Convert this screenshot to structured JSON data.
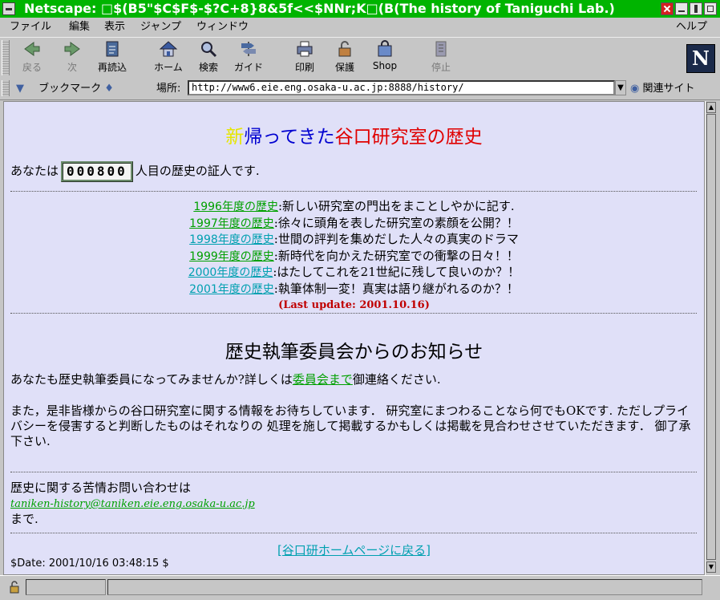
{
  "window": {
    "title": "Netscape: □$(B5\"$C$F$-$?C+8}8&5f<<$NNr;K□(B(The history of Taniguchi Lab.)"
  },
  "menu": {
    "items": [
      "ファイル",
      "編集",
      "表示",
      "ジャンプ",
      "ウィンドウ"
    ],
    "help": "ヘルプ"
  },
  "toolbar": {
    "back": "戻る",
    "forward": "次",
    "reload": "再読込",
    "home": "ホーム",
    "search": "検索",
    "guide": "ガイド",
    "print": "印刷",
    "security": "保護",
    "shop": "Shop",
    "stop": "停止"
  },
  "location": {
    "bookmarks": "ブックマーク",
    "label": "場所:",
    "url": "http://www6.eie.eng.osaka-u.ac.jp:8888/history/",
    "related": "関連サイト"
  },
  "page": {
    "title_part1": "新",
    "title_part2": "帰ってきた",
    "title_part3": "谷口研究室の歴史",
    "counter_prefix": "あなたは",
    "counter_value": "000800",
    "counter_suffix": "人目の歴史の証人です.",
    "history": [
      {
        "link": "1996年度の歴史",
        "desc": ":新しい研究室の門出をまことしやかに記す.",
        "color": "#00a000"
      },
      {
        "link": "1997年度の歴史",
        "desc": ":徐々に頭角を表した研究室の素顔を公開？！",
        "color": "#00a000"
      },
      {
        "link": "1998年度の歴史",
        "desc": ":世間の評判を集めだした人々の真実のドラマ",
        "color": "#00a0b0"
      },
      {
        "link": "1999年度の歴史",
        "desc": ":新時代を向かえた研究室での衝撃の日々！！",
        "color": "#00a000"
      },
      {
        "link": "2000年度の歴史",
        "desc": ":はたしてこれを21世紀に残して良いのか？！",
        "color": "#00a0b0"
      },
      {
        "link": "2001年度の歴史",
        "desc": ":執筆体制一変！真実は語り継がれるのか？！",
        "color": "#00a0b0"
      }
    ],
    "last_update": "(Last update: 2001.10.16)",
    "notice_title": "歴史執筆委員会からのお知らせ",
    "invite_prefix": "あなたも歴史執筆委員になってみませんか?詳しくは",
    "invite_link": "委員会まで",
    "invite_suffix": "御連絡ください.",
    "info_para": "また，是非皆様からの谷口研究室に関する情報をお待ちしています． 研究室にまつわることなら何でもOKです. ただしプライバシーを侵害すると判断したものはそれなりの 処理を施して掲載するかもしくは掲載を見合わせさせていただきます． 御了承下さい.",
    "complaint_text": "歴史に関する苦情お問い合わせは",
    "email": "taniken-history@taniken.eie.eng.osaka-u.ac.jp",
    "made": "まで.",
    "back_link": "[谷口研ホームページに戻る]",
    "date": "$Date: 2001/10/16 03:48:15 $"
  }
}
